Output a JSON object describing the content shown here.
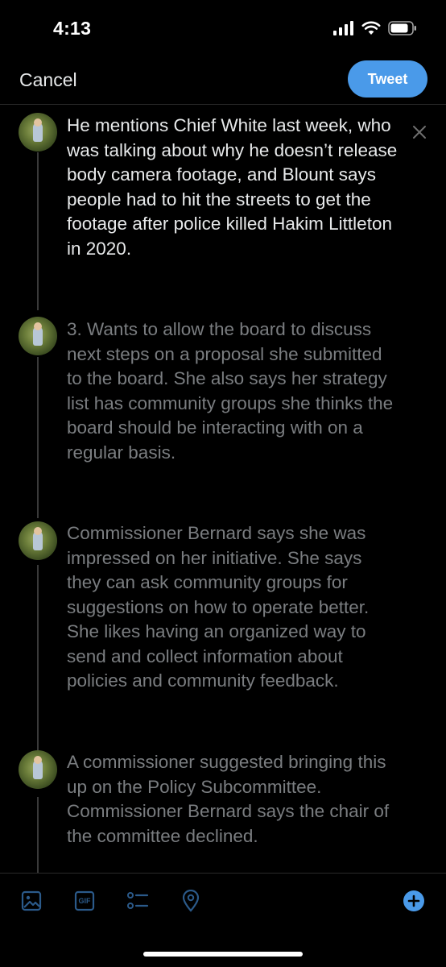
{
  "status_bar": {
    "time": "4:13"
  },
  "nav": {
    "cancel_label": "Cancel",
    "tweet_label": "Tweet"
  },
  "thread": {
    "tweets": [
      {
        "text": "He mentions Chief White last week, who was talking about why he doesn’t release body camera footage, and Blount says people had to hit the streets to get the footage after police killed Hakim Littleton in 2020."
      },
      {
        "text": "3. Wants to allow the board to discuss next steps on a proposal she submitted to the board. She also says her strategy list has community groups she thinks the board should be interacting with on a regular basis."
      },
      {
        "text": "Commissioner Bernard says she was impressed on her initiative. She says they can ask community groups for suggestions on how to operate better. She likes having an organized way to send and collect information about policies and community feedback."
      },
      {
        "text": "A commissioner suggested bringing this up on the Policy Subcommittee. Commissioner Bernard says the chair of the committee declined."
      }
    ]
  },
  "toolbar": {
    "icons": [
      "image-icon",
      "gif-icon",
      "poll-icon",
      "location-icon",
      "add-tweet-icon"
    ],
    "gif_label": "GIF"
  },
  "colors": {
    "accent": "#4a9ae9",
    "background": "#000000",
    "dim_text": "#7a7d80"
  }
}
